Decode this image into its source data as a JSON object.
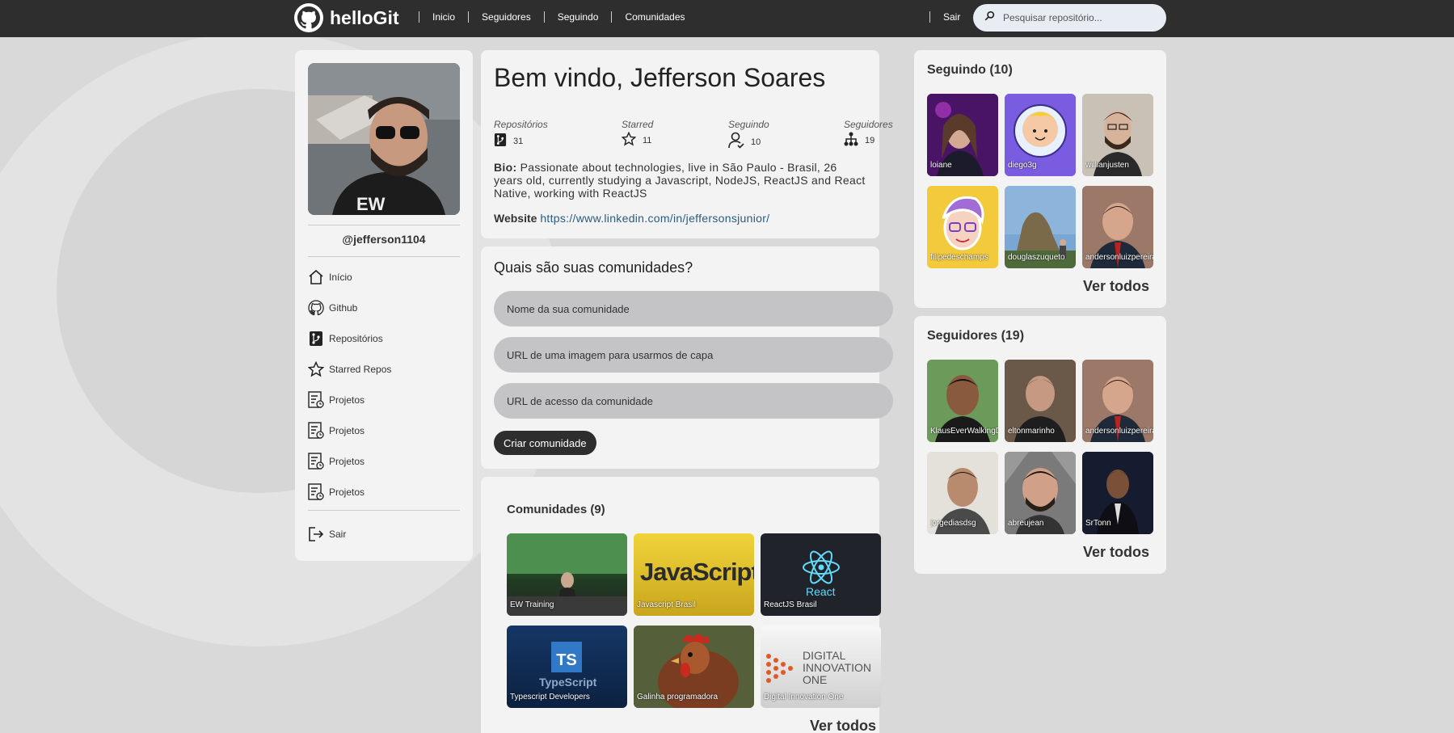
{
  "header": {
    "brand": "helloGit",
    "nav": [
      "Inicio",
      "Seguidores",
      "Seguindo",
      "Comunidades"
    ],
    "logout": "Sair",
    "search_placeholder": "Pesquisar repositório..."
  },
  "sidebar": {
    "handle": "@jefferson1104",
    "items": [
      {
        "label": "Início",
        "icon": "home-icon"
      },
      {
        "label": "Github",
        "icon": "github-icon"
      },
      {
        "label": "Repositórios",
        "icon": "repo-icon"
      },
      {
        "label": "Starred Repos",
        "icon": "star-icon"
      },
      {
        "label": "Projetos",
        "icon": "project-icon"
      },
      {
        "label": "Projetos",
        "icon": "project-icon"
      },
      {
        "label": "Projetos",
        "icon": "project-icon"
      },
      {
        "label": "Projetos",
        "icon": "project-icon"
      }
    ],
    "logout": "Sair"
  },
  "profile": {
    "welcome": "Bem vindo, Jefferson Soares",
    "stats": [
      {
        "label": "Repositórios",
        "value": "31"
      },
      {
        "label": "Starred",
        "value": "11"
      },
      {
        "label": "Seguindo",
        "value": "10"
      },
      {
        "label": "Seguidores",
        "value": "19"
      }
    ],
    "bio_label": "Bio:",
    "bio": "Passionate about technologies, live in São Paulo - Brasil, 26 years old, currently studying a Javascript, NodeJS, ReactJS and React Native, working with ReactJS",
    "website_label": "Website",
    "website": "https://www.linkedin.com/in/jeffersonsjunior/"
  },
  "form": {
    "title": "Quais são suas comunidades?",
    "name_placeholder": "Nome da sua comunidade",
    "image_placeholder": "URL de uma imagem para usarmos de capa",
    "url_placeholder": "URL de acesso da comunidade",
    "submit": "Criar comunidade"
  },
  "communities": {
    "title": "Comunidades (9)",
    "items": [
      "EW Training",
      "Javascript Brasil",
      "ReactJS Brasil",
      "Typescript Developers",
      "Galinha programadora",
      "Digital Innovation One"
    ],
    "see_all": "Ver todos",
    "tile_text": {
      "javascript": "JavaScript",
      "react": "React",
      "ts": "TS",
      "typescript": "TypeScript",
      "dio": [
        "DIGITAL",
        "INNOVATION",
        "ONE"
      ]
    }
  },
  "following": {
    "title": "Seguindo (10)",
    "people": [
      "loiane",
      "diego3g",
      "willianjusten",
      "filipedeschamps",
      "douglaszuqueto",
      "andersonluizpereira"
    ],
    "see_all": "Ver todos"
  },
  "followers": {
    "title": "Seguidores (19)",
    "people": [
      "KlausEverWalkingDev",
      "eltonmarinho",
      "andersonluizpereira",
      "jorgediasdsg",
      "abreujean",
      "SrTonn"
    ],
    "see_all": "Ver todos"
  },
  "colors": {
    "header": "#2e2e2e",
    "panel": "#f3f3f3",
    "input": "#c4c4c6",
    "link": "#2a5b84"
  }
}
